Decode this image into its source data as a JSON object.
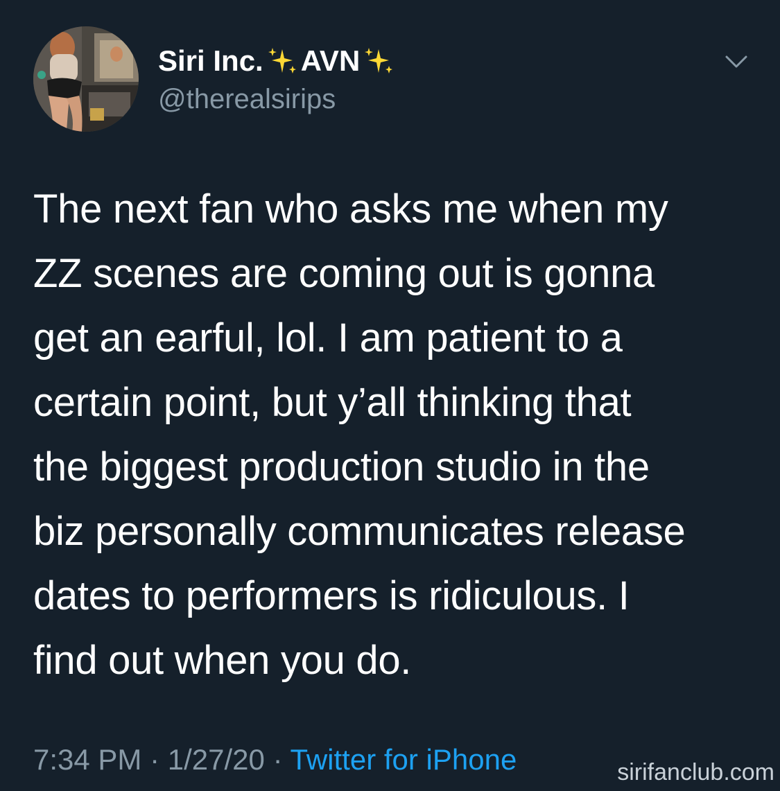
{
  "tweet": {
    "display_name_part1": "Siri Inc.",
    "display_name_part2": "AVN",
    "handle": "@therealsirips",
    "text_lines": [
      "The next fan who asks me when my",
      "ZZ scenes are coming out is gonna",
      "get an earful, lol. I am patient to a",
      "certain point, but y’all thinking that",
      "the biggest production studio in the",
      "biz personally communicates release",
      "dates to performers is ridiculous. I",
      "find out when you do."
    ],
    "time": "7:34 PM",
    "separator": "·",
    "date": "1/27/20",
    "source": "Twitter for iPhone"
  },
  "watermark": "sirifanclub.com",
  "icons": {
    "more": "chevron-down-icon",
    "sparkles": "sparkles-icon",
    "avatar": "avatar"
  },
  "colors": {
    "background": "#15202b",
    "text": "#ffffff",
    "secondary": "#8899a6",
    "link": "#1da1f2",
    "sparkle": "#fdd835"
  }
}
